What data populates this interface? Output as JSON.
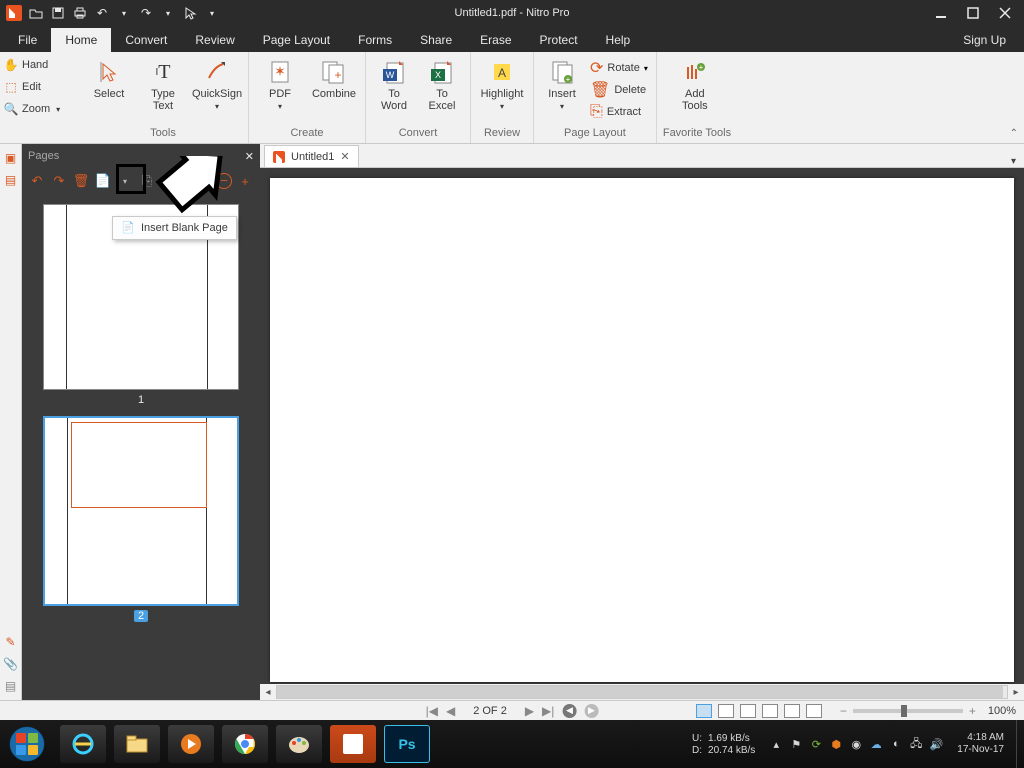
{
  "title": "Untitled1.pdf - Nitro Pro",
  "menutabs": {
    "file": "File",
    "home": "Home",
    "convert": "Convert",
    "review": "Review",
    "page_layout": "Page Layout",
    "forms": "Forms",
    "share": "Share",
    "erase": "Erase",
    "protect": "Protect",
    "help": "Help",
    "signup": "Sign Up"
  },
  "leftquick": {
    "hand": "Hand",
    "edit": "Edit",
    "zoom": "Zoom"
  },
  "ribbon": {
    "tools": {
      "select": "Select",
      "type": "Type\nText",
      "quicksign": "QuickSign",
      "label": "Tools"
    },
    "create": {
      "pdf": "PDF",
      "combine": "Combine",
      "label": "Create"
    },
    "convert": {
      "word": "To\nWord",
      "excel": "To\nExcel",
      "label": "Convert"
    },
    "review": {
      "highlight": "Highlight",
      "label": "Review"
    },
    "page_layout": {
      "insert": "Insert",
      "rotate": "Rotate",
      "delete": "Delete",
      "extract": "Extract",
      "label": "Page Layout"
    },
    "favorite": {
      "add": "Add\nTools",
      "label": "Favorite Tools"
    }
  },
  "pages_panel": {
    "title": "Pages",
    "tooltip": "Insert Blank Page",
    "thumb1": "1",
    "thumb2": "2"
  },
  "doctab": {
    "name": "Untitled1"
  },
  "status": {
    "page": "2 OF 2",
    "zoom": "100%"
  },
  "net": {
    "u_label": "U:",
    "d_label": "D:",
    "u": "1.69 kB/s",
    "d": "20.74 kB/s"
  },
  "clock": {
    "time": "4:18 AM",
    "date": "17-Nov-17"
  }
}
